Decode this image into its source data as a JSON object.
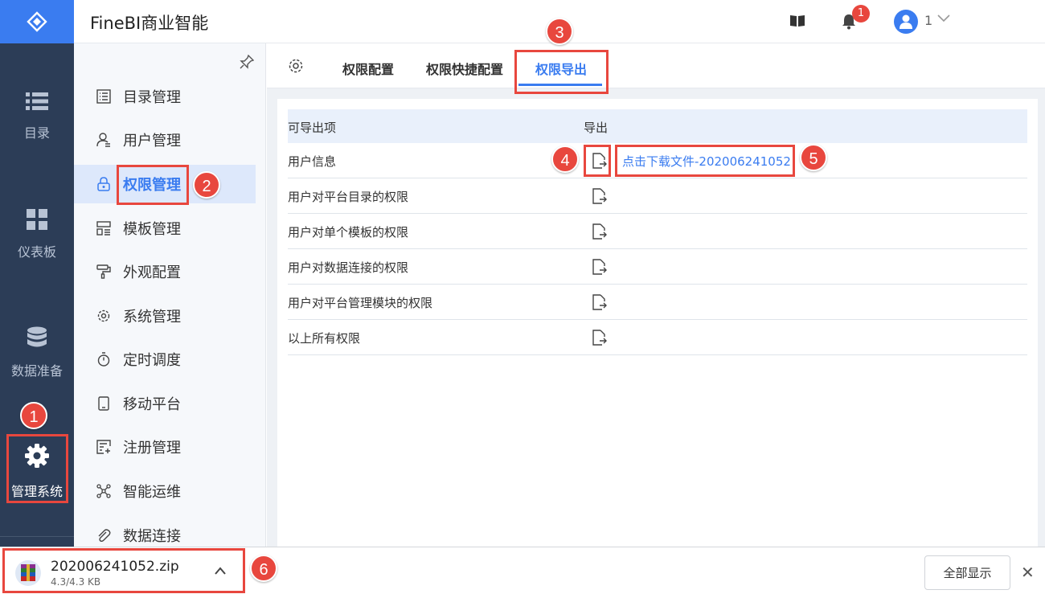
{
  "app": {
    "title": "FineBI商业智能",
    "user": "1",
    "notification_count": "1"
  },
  "rail": {
    "items": [
      {
        "label": "目录",
        "icon": "list-icon"
      },
      {
        "label": "仪表板",
        "icon": "dashboard-icon"
      },
      {
        "label": "数据准备",
        "icon": "database-icon"
      },
      {
        "label": "管理系统",
        "icon": "gear-icon",
        "active": true
      }
    ]
  },
  "submenu": {
    "items": [
      {
        "label": "目录管理",
        "icon": "catalog-icon"
      },
      {
        "label": "用户管理",
        "icon": "user-icon"
      },
      {
        "label": "权限管理",
        "icon": "lock-icon",
        "active": true
      },
      {
        "label": "模板管理",
        "icon": "template-icon"
      },
      {
        "label": "外观配置",
        "icon": "paint-roller-icon"
      },
      {
        "label": "系统管理",
        "icon": "gear-icon"
      },
      {
        "label": "定时调度",
        "icon": "timer-icon"
      },
      {
        "label": "移动平台",
        "icon": "mobile-icon"
      },
      {
        "label": "注册管理",
        "icon": "register-icon"
      },
      {
        "label": "智能运维",
        "icon": "network-icon"
      },
      {
        "label": "数据连接",
        "icon": "paperclip-icon"
      }
    ]
  },
  "tabs": [
    {
      "label": "权限配置"
    },
    {
      "label": "权限快捷配置"
    },
    {
      "label": "权限导出",
      "active": true
    }
  ],
  "table": {
    "headers": [
      "可导出项",
      "导出"
    ],
    "rows": [
      {
        "name": "用户信息",
        "download": "点击下载文件-202006241052"
      },
      {
        "name": "用户对平台目录的权限"
      },
      {
        "name": "用户对单个模板的权限"
      },
      {
        "name": "用户对数据连接的权限"
      },
      {
        "name": "用户对平台管理模块的权限"
      },
      {
        "name": "以上所有权限"
      }
    ]
  },
  "annotations": [
    "1",
    "2",
    "3",
    "4",
    "5",
    "6"
  ],
  "download_bar": {
    "file_name": "202006241052.zip",
    "file_size": "4.3/4.3 KB",
    "show_all": "全部显示",
    "close": "✕"
  },
  "colors": {
    "accent": "#3a7cf0",
    "rail": "#2c3d57",
    "annotation": "#e8473e"
  }
}
